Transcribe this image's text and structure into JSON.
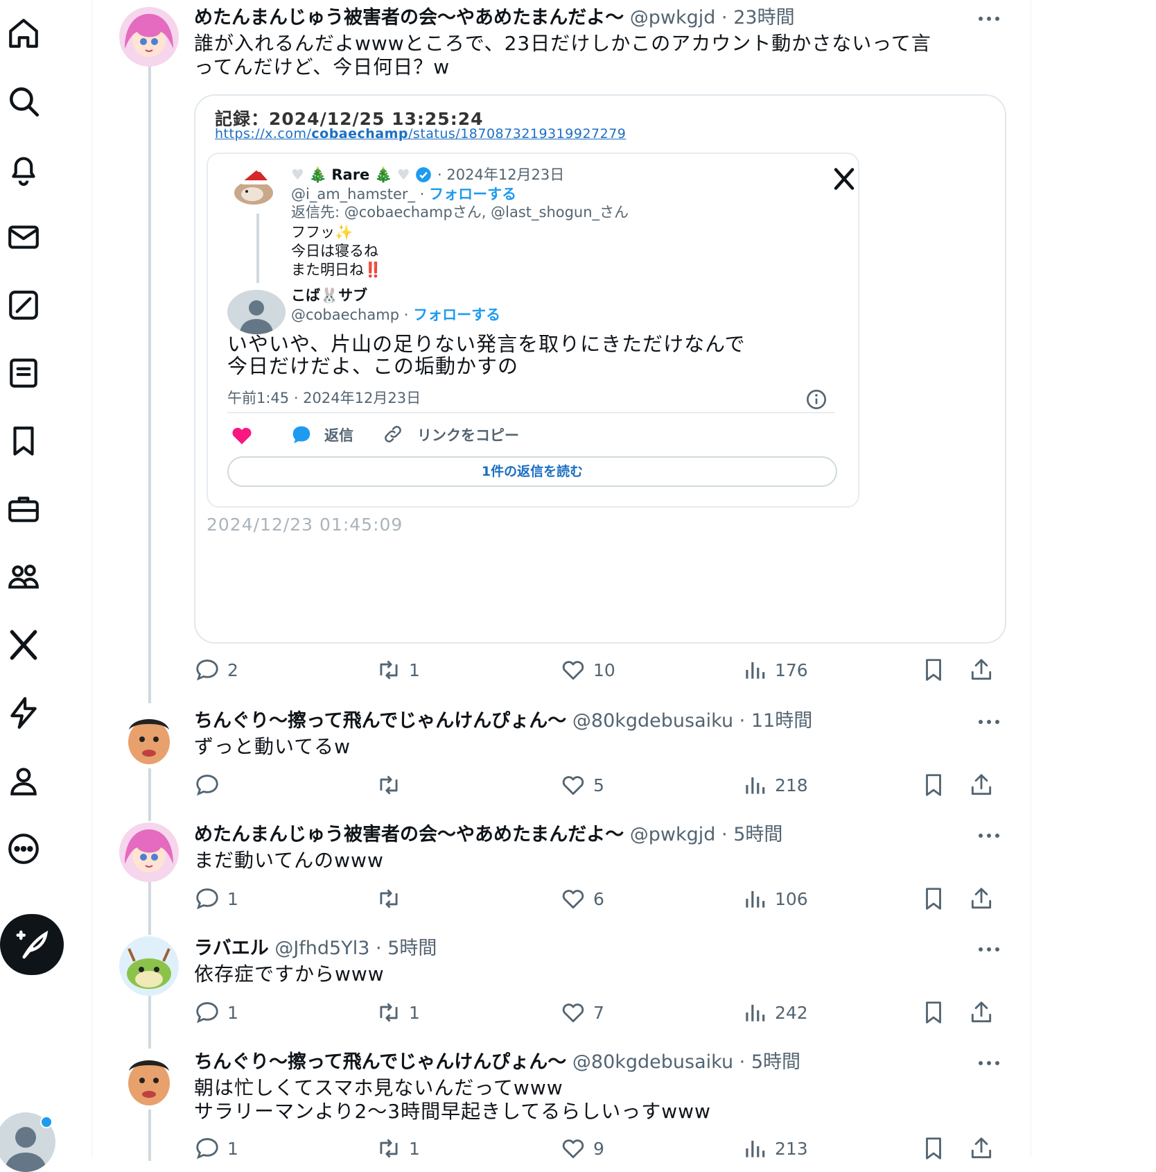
{
  "nav": {
    "items": [
      {
        "icon": "home-icon"
      },
      {
        "icon": "search-icon"
      },
      {
        "icon": "notifications-icon"
      },
      {
        "icon": "messages-icon"
      },
      {
        "icon": "grok-icon"
      },
      {
        "icon": "lists-icon"
      },
      {
        "icon": "bookmarks-icon"
      },
      {
        "icon": "jobs-icon"
      },
      {
        "icon": "communities-icon"
      },
      {
        "icon": "premium-x-icon"
      },
      {
        "icon": "verified-orgs-icon"
      },
      {
        "icon": "profile-icon"
      },
      {
        "icon": "more-icon"
      }
    ],
    "post_button_icon": "compose-icon",
    "accent": "#1d9bf0"
  },
  "posts": [
    {
      "name": "めたんまんじゅう被害者の会〜やあめたまんだよ〜",
      "handle": "@pwkgjd",
      "dot": "·",
      "time": "23時間",
      "lines": [
        "誰が入れるんだよwwwところで、23日だけしかこのアカウント動かさないって言",
        "ってんだけど、今日何日？w"
      ],
      "reply": "2",
      "retweet": "1",
      "like": "10",
      "views": "176"
    },
    {
      "name": "ちんぐり〜擦って飛んでじゃんけんぴょん〜",
      "handle": "@80kgdebusaiku",
      "dot": "·",
      "time": "11時間",
      "lines": [
        "ずっと動いてるw"
      ],
      "reply": "",
      "retweet": "",
      "like": "5",
      "views": "218"
    },
    {
      "name": "めたんまんじゅう被害者の会〜やあめたまんだよ〜",
      "handle": "@pwkgjd",
      "dot": "·",
      "time": "5時間",
      "lines": [
        "まだ動いてんのwww"
      ],
      "reply": "1",
      "retweet": "",
      "like": "6",
      "views": "106"
    },
    {
      "name": "ラバエル",
      "handle": "@Jfhd5Yl3",
      "dot": "·",
      "time": "5時間",
      "lines": [
        "依存症ですからwww"
      ],
      "reply": "1",
      "retweet": "1",
      "like": "7",
      "views": "242"
    },
    {
      "name": "ちんぐり〜擦って飛んでじゃんけんぴょん〜",
      "handle": "@80kgdebusaiku",
      "dot": "·",
      "time": "5時間",
      "lines": [
        "朝は忙しくてスマホ見ないんだってwww",
        "サラリーマンより2〜3時間早起きしてるらしいっすwww"
      ],
      "reply": "1",
      "retweet": "1",
      "like": "9",
      "views": "213"
    }
  ],
  "card": {
    "record": "記録：2024/12/25 13:25:24",
    "url_prefix": "https://x.com/",
    "url_bold": "cobaechamp",
    "url_suffix": "/status/1870873219319927279",
    "footer_time": "2024/12/23 01:45:09",
    "embed": {
      "parent_name": "Rare",
      "parent_date": "· 2024年12月23日",
      "parent_handle": "@i_am_hamster_",
      "handle_sep": "·",
      "follow": "フォローする",
      "reply_to": "返信先: @cobaechampさん, @last_shogun_さん",
      "parent_lines": [
        "フフッ✨",
        "今日は寝るね",
        "また明日ね‼️"
      ],
      "author_name": "こば🐰サブ",
      "author_handle": "@cobaechamp",
      "main_lines": [
        "いやいや、片山の足りない発言を取りにきただけなんで",
        "今日だけだよ、この垢動かすの"
      ],
      "timestamp": "午前1:45 · 2024年12月23日",
      "reply_label": "返信",
      "copy_label": "リンクをコピー",
      "read_more": "1件の返信を読む",
      "like_color": "#f91880",
      "reply_color": "#1d9bf0"
    }
  }
}
